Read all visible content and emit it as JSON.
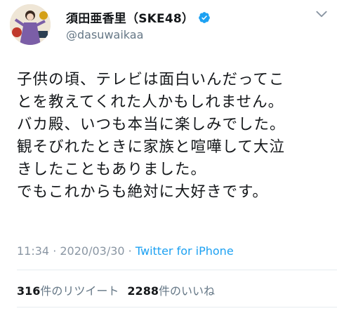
{
  "user": {
    "display_name": "須田亜香里（SKE48）",
    "handle": "@dasuwaikaa",
    "verified": true
  },
  "tweet": {
    "lines": [
      "子供の頃、テレビは面白いんだってこ",
      "とを教えてくれた人かもしれません。",
      "バカ殿、いつも本当に楽しみでした。",
      "観そびれたときに家族と喧嘩して大泣",
      "きしたこともありました。",
      "でもこれからも絶対に大好きです。"
    ],
    "time": "11:34",
    "separator": " · ",
    "date": "2020/03/30",
    "source": "Twitter for iPhone"
  },
  "stats": {
    "retweets_count": "316",
    "retweets_label": "件のリツイート",
    "likes_count": "2288",
    "likes_label": "件のいいね"
  },
  "icons": {
    "verified": "verified-badge-icon",
    "menu": "chevron-down-icon"
  },
  "colors": {
    "link": "#1da1f2",
    "text": "#14171a",
    "muted": "#657786"
  }
}
